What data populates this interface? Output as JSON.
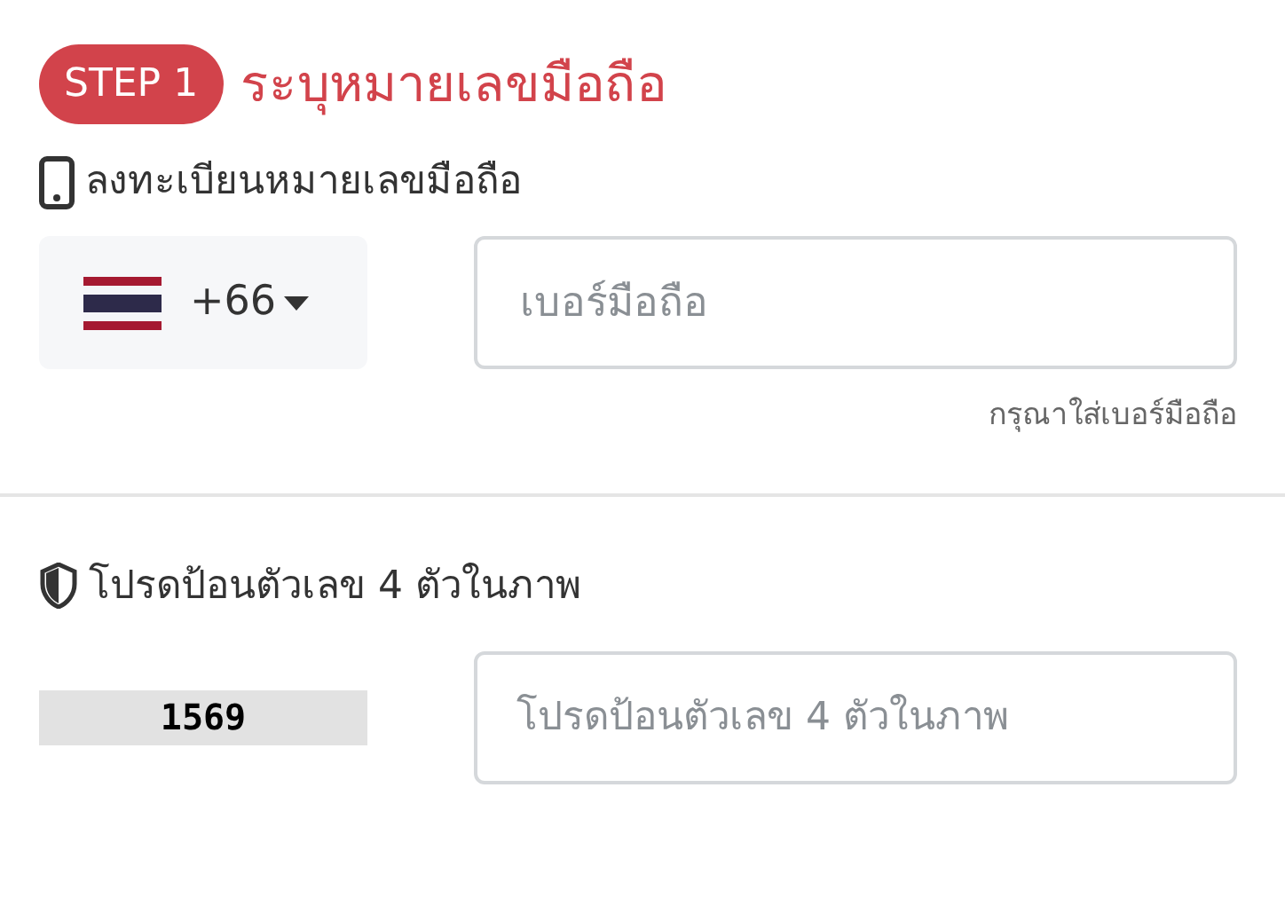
{
  "step_badge": "STEP 1",
  "title": "ระบุหมายเลขมือถือ",
  "phone_section": {
    "label": "ลงทะเบียนหมายเลขมือถือ",
    "country_code": "+66",
    "phone_input": {
      "placeholder": "เบอร์มือถือ"
    },
    "helper": "กรุณาใส่เบอร์มือถือ"
  },
  "captcha_section": {
    "label": "โปรดป้อนตัวเลข 4 ตัวในภาพ",
    "captcha_code": "1569",
    "captcha_input": {
      "placeholder": "โปรดป้อนตัวเลข 4 ตัวในภาพ"
    }
  }
}
